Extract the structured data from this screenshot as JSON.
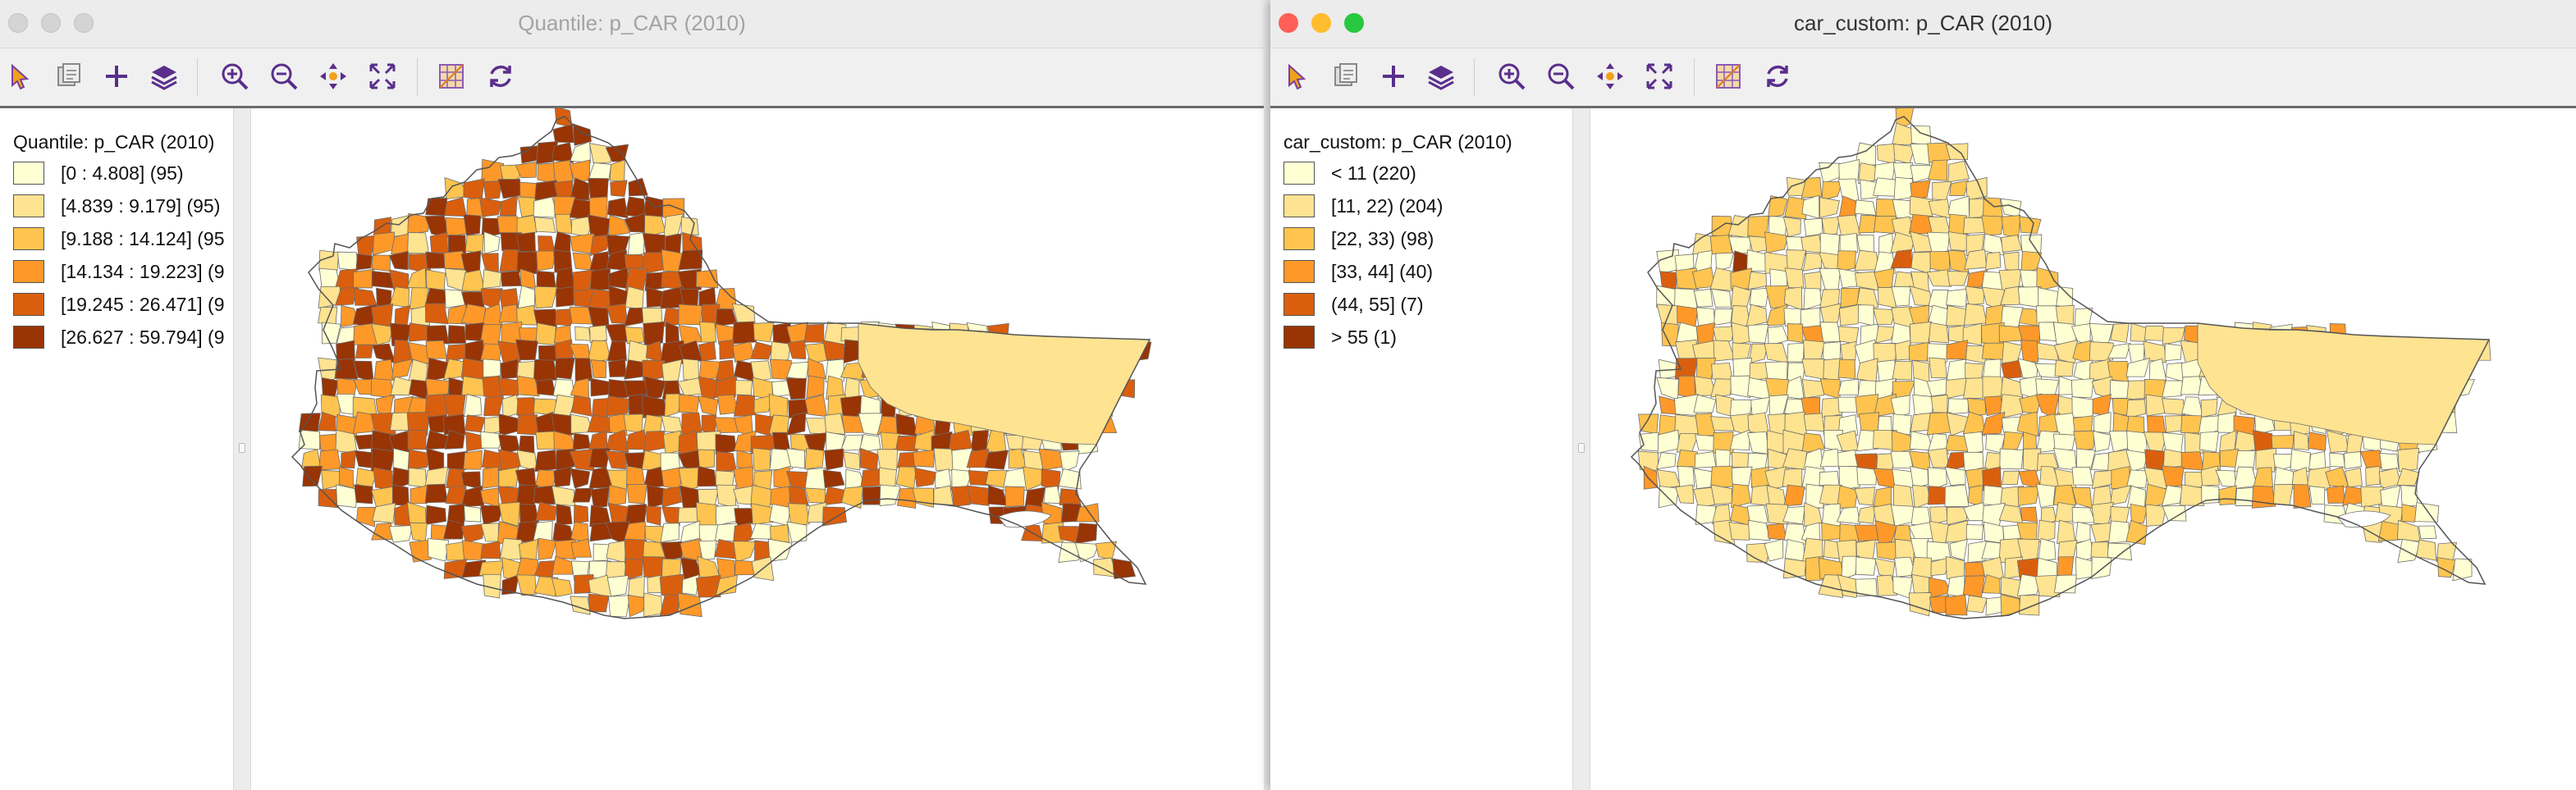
{
  "windows": [
    {
      "title": "Quantile: p_CAR (2010)",
      "legend": {
        "title": "Quantile: p_CAR (2010)",
        "items": [
          {
            "label": "[0 : 4.808] (95)",
            "color": "#ffffd4"
          },
          {
            "label": "[4.839 : 9.179] (95)",
            "color": "#fee391"
          },
          {
            "label": "[9.188 : 14.124] (95",
            "color": "#fec44f"
          },
          {
            "label": "[14.134 : 19.223] (9",
            "color": "#fe9929"
          },
          {
            "label": "[19.245 : 26.471] (9",
            "color": "#d95f0e"
          },
          {
            "label": "[26.627 : 59.794] (9",
            "color": "#993404"
          }
        ]
      }
    },
    {
      "title": "car_custom: p_CAR (2010)",
      "legend": {
        "title": "car_custom: p_CAR (2010)",
        "items": [
          {
            "label": "< 11 (220)",
            "color": "#ffffd4"
          },
          {
            "label": "[11, 22) (204)",
            "color": "#fee391"
          },
          {
            "label": "[22, 33) (98)",
            "color": "#fec44f"
          },
          {
            "label": "[33, 44] (40)",
            "color": "#fe9929"
          },
          {
            "label": "(44, 55] (7)",
            "color": "#d95f0e"
          },
          {
            "label": "> 55 (1)",
            "color": "#993404"
          }
        ]
      }
    }
  ],
  "toolbar_icons": [
    "select-pointer-icon",
    "selection-tool-icon",
    "add-icon",
    "layers-icon",
    "zoom-in-icon",
    "zoom-out-icon",
    "pan-icon",
    "full-extent-icon",
    "map-options-icon",
    "refresh-icon"
  ]
}
